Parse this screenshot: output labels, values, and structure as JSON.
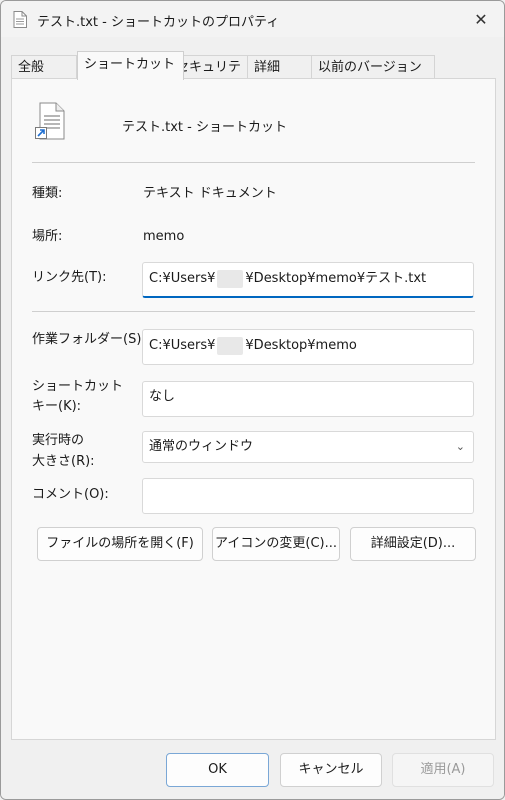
{
  "window": {
    "title": "テスト.txt - ショートカットのプロパティ",
    "close_glyph": "✕"
  },
  "tabs": [
    {
      "label": "全般"
    },
    {
      "label": "ショートカット"
    },
    {
      "label": "セキュリティ"
    },
    {
      "label": "詳細"
    },
    {
      "label": "以前のバージョン"
    }
  ],
  "header": {
    "file_name": "テスト.txt - ショートカット"
  },
  "fields": {
    "type_label": "種類:",
    "type_value": "テキスト ドキュメント",
    "location_label": "場所:",
    "location_value": "memo",
    "target_label": "リンク先(T):",
    "target_prefix": "C:¥Users¥",
    "target_suffix": "¥Desktop¥memo¥テスト.txt",
    "workdir_label": "作業フォルダー(S):",
    "workdir_prefix": "C:¥Users¥",
    "workdir_suffix": "¥Desktop¥memo",
    "hotkey_label_1": "ショートカット",
    "hotkey_label_2": "キー(K):",
    "hotkey_value": "なし",
    "run_label_1": "実行時の",
    "run_label_2": "大きさ(R):",
    "run_value": "通常のウィンドウ",
    "comment_label": "コメント(O):",
    "comment_value": ""
  },
  "actions": {
    "open_location": "ファイルの場所を開く(F)",
    "change_icon": "アイコンの変更(C)...",
    "advanced": "詳細設定(D)..."
  },
  "footer": {
    "ok": "OK",
    "cancel": "キャンセル",
    "apply": "適用(A)"
  }
}
